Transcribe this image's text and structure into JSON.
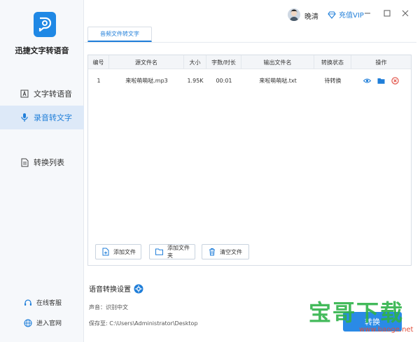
{
  "app": {
    "title": "迅捷文字转语音"
  },
  "sidebar": {
    "items": [
      {
        "label": "文字转语音",
        "icon": "text-icon"
      },
      {
        "label": "录音转文字",
        "icon": "mic-icon",
        "active": true
      },
      {
        "label": "转换列表",
        "icon": "list-icon"
      }
    ],
    "footer": [
      {
        "label": "在线客服",
        "icon": "headset-icon"
      },
      {
        "label": "进入官网",
        "icon": "globe-icon"
      }
    ]
  },
  "topbar": {
    "username": "晚清",
    "vip_label": "充值VIP"
  },
  "tabs": [
    {
      "label": "音频文件转文字",
      "active": true
    }
  ],
  "table": {
    "headers": [
      "编号",
      "源文件名",
      "大小",
      "字数/时长",
      "输出文件名",
      "转换状态",
      "操作"
    ],
    "rows": [
      {
        "index": "1",
        "source": "来啦萌萌哒.mp3",
        "size": "1.95K",
        "duration": "00:01",
        "output": "来啦萌萌哒.txt",
        "status": "待转换"
      }
    ]
  },
  "actions": {
    "add_file": "添加文件",
    "add_folder": "添加文件夹",
    "clear_files": "清空文件"
  },
  "settings": {
    "title": "语音转换设置",
    "voice": "声音：识别中文",
    "save_to": "保存至: C:\\Users\\Administrator\\Desktop"
  },
  "convert_label": "转换",
  "watermark": {
    "text": "宝哥下载",
    "url": "www.baoge.net"
  },
  "colors": {
    "accent": "#1f7ed9",
    "active_bg": "#dde9f8",
    "delete": "#e0473c",
    "watermark": "#2fb34a"
  }
}
